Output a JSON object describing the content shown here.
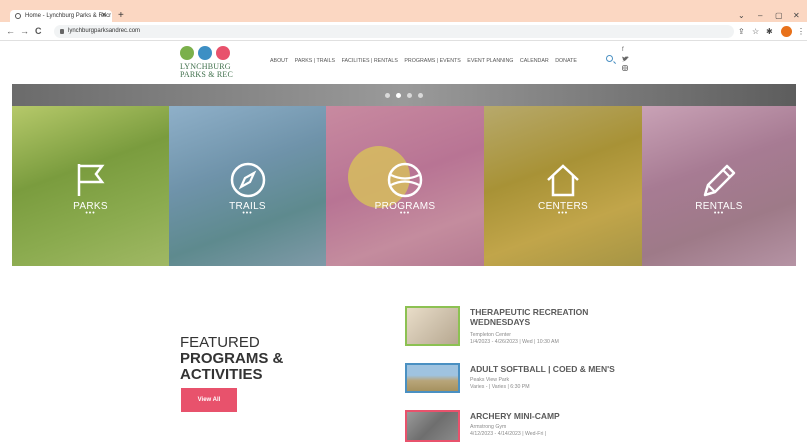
{
  "browser": {
    "tab_title": "Home - Lynchburg Parks & Recr",
    "tab_close": "✕",
    "new_tab": "+",
    "url": "lynchburgparksandrec.com",
    "back_icon": "←",
    "forward_icon": "→",
    "reload_icon": "C",
    "window_min": "–",
    "window_max": "▢",
    "window_close": "✕",
    "window_chevron": "⌄",
    "profile_color": "#e8711a"
  },
  "site": {
    "logo_line1": "LYNCHBURG",
    "logo_line2": "PARKS & REC",
    "nav": [
      "ABOUT",
      "PARKS | TRAILS",
      "FACILITIES | RENTALS",
      "PROGRAMS | EVENTS",
      "EVENT PLANNING",
      "CALENDAR",
      "DONATE"
    ],
    "social": [
      "f",
      "t",
      "ig"
    ]
  },
  "hero": {
    "panels": [
      {
        "label": "PARKS",
        "icon": "flag-icon"
      },
      {
        "label": "TRAILS",
        "icon": "compass-icon"
      },
      {
        "label": "PROGRAMS",
        "icon": "ball-icon"
      },
      {
        "label": "CENTERS",
        "icon": "house-icon"
      },
      {
        "label": "RENTALS",
        "icon": "pencil-icon"
      }
    ],
    "slide_dots": 4,
    "active_dot": 1
  },
  "featured": {
    "line1": "FEATURED",
    "line2": "PROGRAMS &",
    "line3": "ACTIVITIES",
    "button": "View All"
  },
  "events": [
    {
      "title1": "THERAPEUTIC RECREATION",
      "title2": "WEDNESDAYS",
      "location": "Templeton Center",
      "dates": "1/4/2023 - 4/26/2023 | Wed | 10:30 AM"
    },
    {
      "title1": "ADULT SOFTBALL | COED & MEN'S",
      "title2": "",
      "location": "Peaks View Park",
      "dates": "Varies - | Varies | 6:30 PM"
    },
    {
      "title1": "ARCHERY MINI-CAMP",
      "title2": "",
      "location": "Armstrong Gym",
      "dates": "4/12/2023 - 4/14/2023 | Wed-Fri |"
    }
  ]
}
